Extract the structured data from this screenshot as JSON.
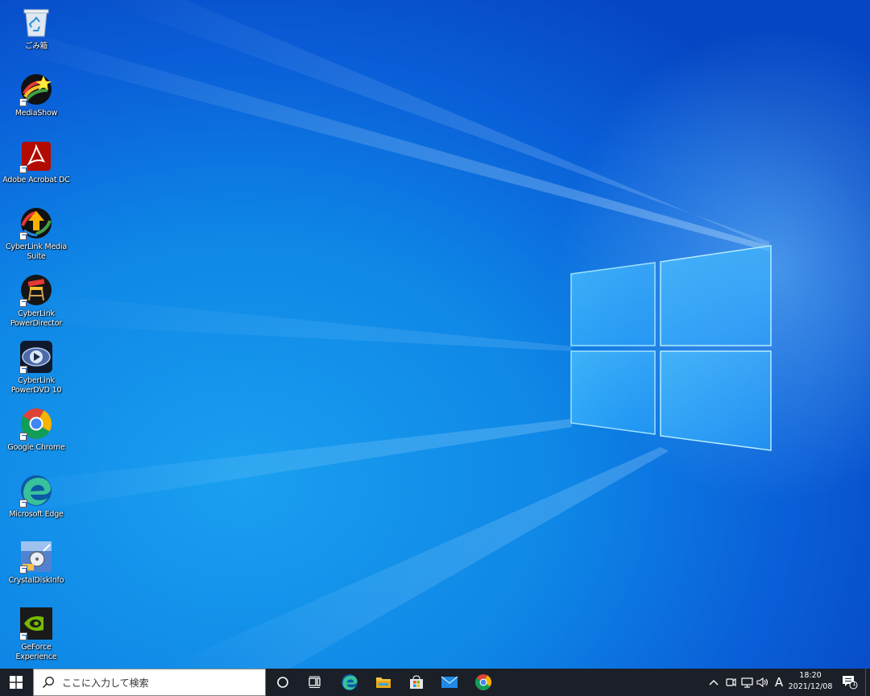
{
  "desktop": {
    "icons": [
      {
        "label": "ごみ箱",
        "icon": "recycle-bin-icon"
      },
      {
        "label": "MediaShow",
        "icon": "mediashow-icon"
      },
      {
        "label": "Adobe Acrobat DC",
        "icon": "adobe-acrobat-icon"
      },
      {
        "label": "CyberLink Media Suite",
        "icon": "cyberlink-media-suite-icon"
      },
      {
        "label": "CyberLink PowerDirector",
        "icon": "cyberlink-powerdirector-icon"
      },
      {
        "label": "CyberLink PowerDVD 10",
        "icon": "cyberlink-powerdvd-icon"
      },
      {
        "label": "Google Chrome",
        "icon": "google-chrome-icon"
      },
      {
        "label": "Microsoft Edge",
        "icon": "microsoft-edge-icon"
      },
      {
        "label": "CrystalDiskInfo",
        "icon": "crystaldiskinfo-icon"
      },
      {
        "label": "GeForce Experience",
        "icon": "geforce-experience-icon"
      }
    ]
  },
  "taskbar": {
    "search_placeholder": "ここに入力して検索",
    "pinned": [
      "cortana-icon",
      "task-view-icon",
      "edge-icon",
      "file-explorer-icon",
      "microsoft-store-icon",
      "mail-icon",
      "chrome-icon"
    ],
    "tray": {
      "ime_label": "A",
      "time": "18:20",
      "date": "2021/12/08",
      "notification_count": "1"
    }
  },
  "colors": {
    "taskbar_bg": "#1b1f27",
    "wallpaper_blue": "#0e86e6"
  }
}
